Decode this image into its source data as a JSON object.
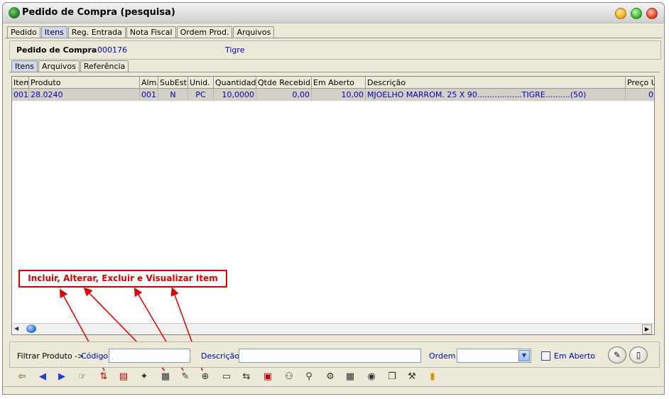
{
  "window": {
    "title": "Pedido de Compra  (pesquisa)"
  },
  "main_tabs": [
    "Pedido",
    "Itens",
    "Reg. Entrada",
    "Nota Fiscal",
    "Ordem Prod.",
    "Arquivos"
  ],
  "header": {
    "label": "Pedido de Compra",
    "number": "000176",
    "supplier": "Tigre"
  },
  "sub_tabs": [
    "Itens",
    "Arquivos",
    "Referência"
  ],
  "grid": {
    "columns": [
      "Item",
      "Produto",
      "Alm.",
      "SubEst",
      "Unid.",
      "Quantidade",
      "Qtde Recebida",
      "Em Aberto",
      "Descrição",
      "Preço U"
    ],
    "rows": [
      {
        "item": "001",
        "produto": "28.0240",
        "alm": "001",
        "subest": "N",
        "unid": "PC",
        "quantidade": "10,0000",
        "qtde_recebida": "0,00",
        "em_aberto": "10,00",
        "descricao": "MJOELHO MARROM. 25 X 90..................TIGRE..........(50)",
        "preco": "0"
      }
    ]
  },
  "annotation": "Incluir, Alterar, Excluir e Visualizar Item",
  "filter": {
    "label": "Filtrar Produto ->",
    "codigo_label": "Código",
    "codigo_value": "",
    "descricao_label": "Descrição",
    "descricao_value": "",
    "ordem_label": "Ordem",
    "ordem_value": "",
    "em_aberto_label": "Em Aberto"
  },
  "toolbar_icons": [
    "exit-door-icon",
    "prev-record-icon",
    "next-record-icon",
    "hand-pointer-icon",
    "sort-icon",
    "include-item-icon",
    "tools-icon",
    "alter-item-icon",
    "exclude-item-icon",
    "view-zoom-icon",
    "card-icon",
    "transfer-icon",
    "export-icon",
    "group-icon",
    "search-doc-icon",
    "gears-icon",
    "calendar-icon",
    "cd-icon",
    "copy-icon",
    "settings-icon",
    "book-icon"
  ],
  "colors": {
    "accent_blue": "#0000c0",
    "annotation_red": "#e00000",
    "row_bg": "#d4d0c8"
  }
}
